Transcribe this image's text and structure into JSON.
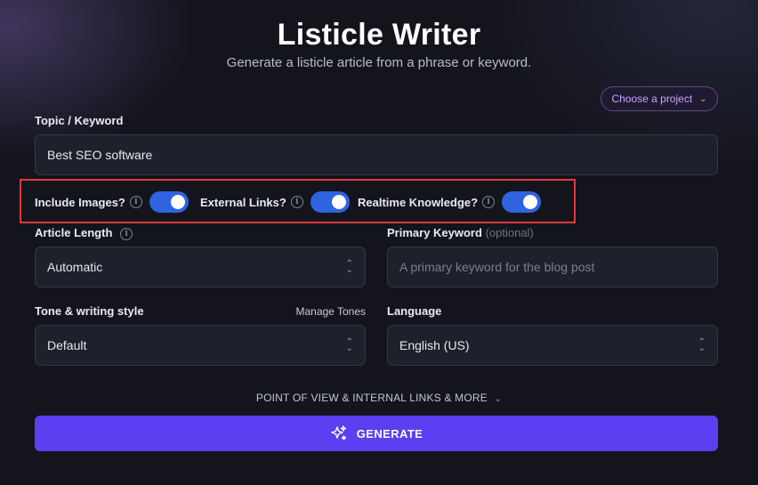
{
  "header": {
    "title": "Listicle Writer",
    "subtitle": "Generate a listicle article from a phrase or keyword."
  },
  "project": {
    "label": "Choose a project",
    "icon": "chevron-down-icon"
  },
  "topic": {
    "label": "Topic / Keyword",
    "value": "Best SEO software"
  },
  "toggles": [
    {
      "label": "Include Images?",
      "on": true
    },
    {
      "label": "External Links?",
      "on": true
    },
    {
      "label": "Realtime Knowledge?",
      "on": true
    }
  ],
  "article_length": {
    "label": "Article Length",
    "value": "Automatic"
  },
  "primary_keyword": {
    "label": "Primary Keyword",
    "optional": "(optional)",
    "placeholder": "A primary keyword for the blog post"
  },
  "tone": {
    "label": "Tone & writing style",
    "manage": "Manage Tones",
    "value": "Default"
  },
  "language": {
    "label": "Language",
    "value": "English (US)"
  },
  "more_options": {
    "label": "POINT OF VIEW & INTERNAL LINKS & MORE"
  },
  "generate": {
    "label": "GENERATE",
    "icon": "sparkle-icon",
    "color": "#5b3ff0"
  },
  "colors": {
    "background": "#13141c",
    "toggle_on": "#2f63e0",
    "highlight_border": "#e2393b",
    "project_accent": "#c6a6ff"
  }
}
